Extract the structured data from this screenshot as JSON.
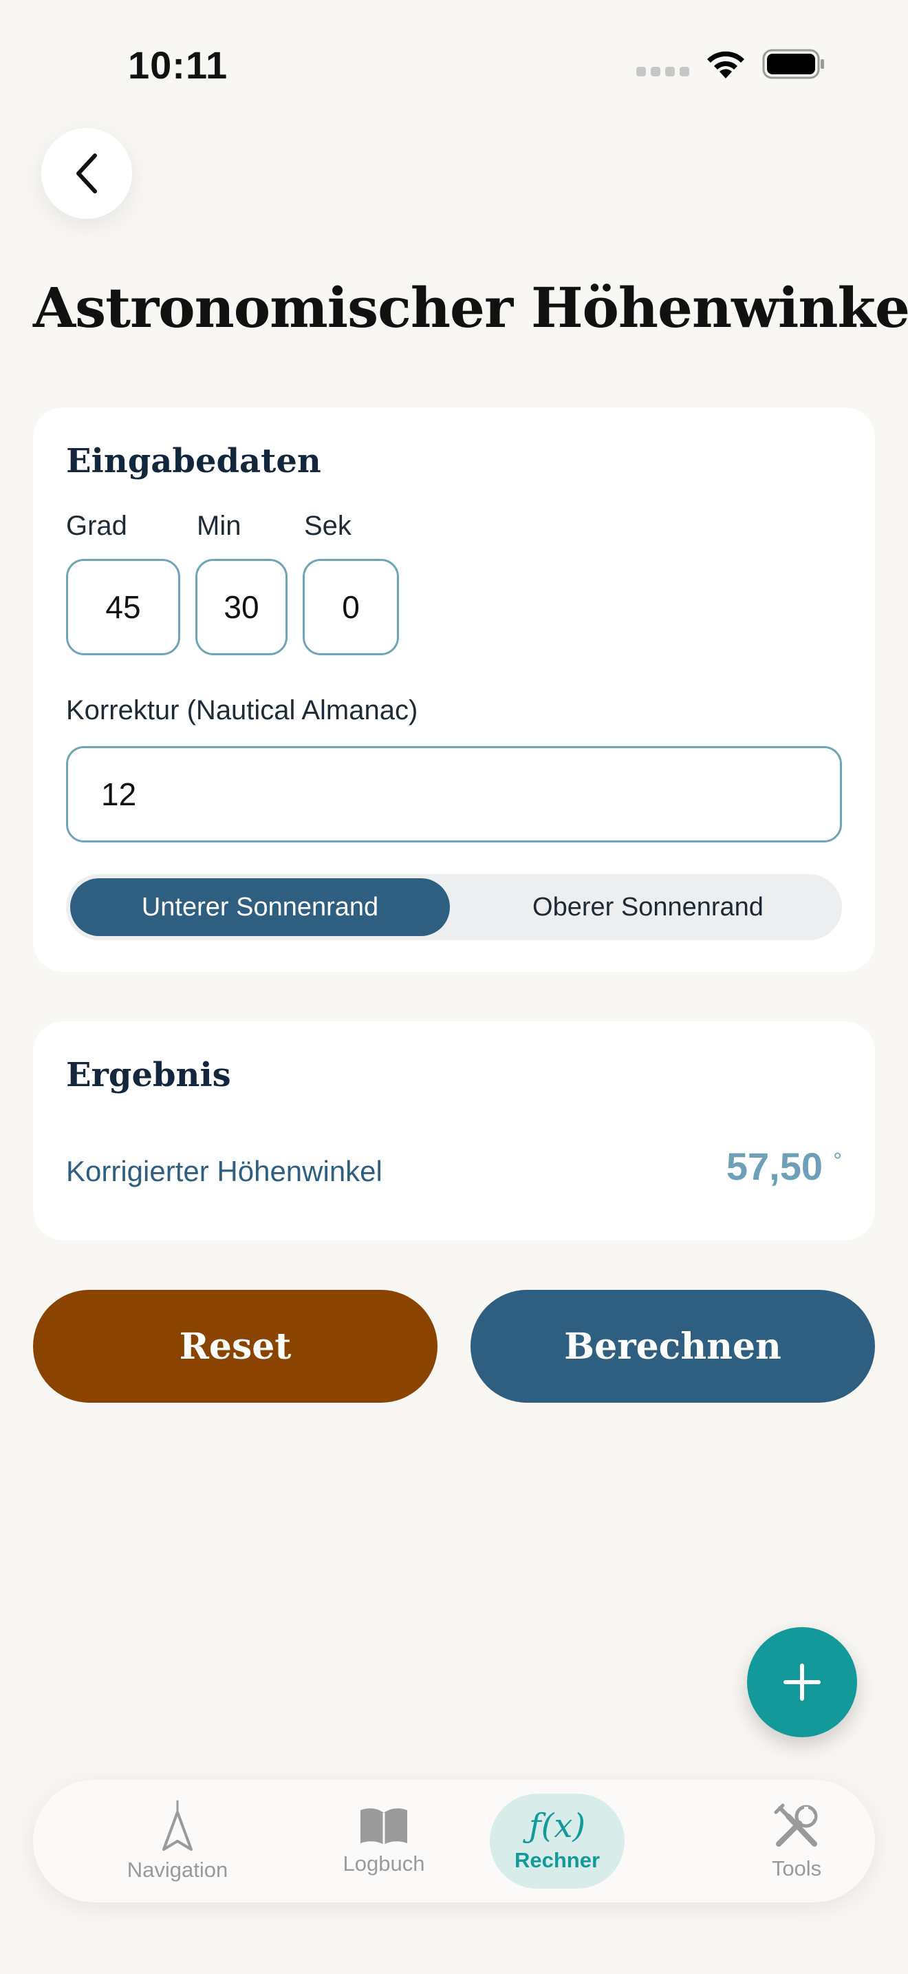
{
  "status_bar": {
    "time": "10:11"
  },
  "header": {
    "title": "Astronomischer Höhenwinkel"
  },
  "input_card": {
    "title": "Eingabedaten",
    "grad": {
      "label": "Grad",
      "value": "45"
    },
    "min": {
      "label": "Min",
      "value": "30"
    },
    "sek": {
      "label": "Sek",
      "value": "0"
    },
    "correction": {
      "label": "Korrektur (Nautical Almanac)",
      "value": "12"
    },
    "limb_segment": {
      "options": [
        "Unterer Sonnenrand",
        "Oberer Sonnenrand"
      ],
      "selected": "Unterer Sonnenrand"
    }
  },
  "result_card": {
    "title": "Ergebnis",
    "label": "Korrigierter Höhenwinkel",
    "value": "57,50",
    "unit": "°"
  },
  "actions": {
    "reset": "Reset",
    "calculate": "Berechnen"
  },
  "tabbar": {
    "items": [
      {
        "label": "Navigation",
        "icon": "navigation-arrow-icon"
      },
      {
        "label": "Logbuch",
        "icon": "book-icon"
      },
      {
        "label": "Rechner",
        "icon": "function-fx-icon",
        "glyph": "ƒ(x)"
      },
      {
        "label": "Tools",
        "icon": "tools-icon"
      }
    ],
    "active": "Rechner"
  },
  "colors": {
    "accent_blue": "#2e5f80",
    "accent_teal": "#13999a",
    "reset_brown": "#8b4400",
    "result_value": "#6e9fb8",
    "input_border": "#6fa4b8"
  }
}
